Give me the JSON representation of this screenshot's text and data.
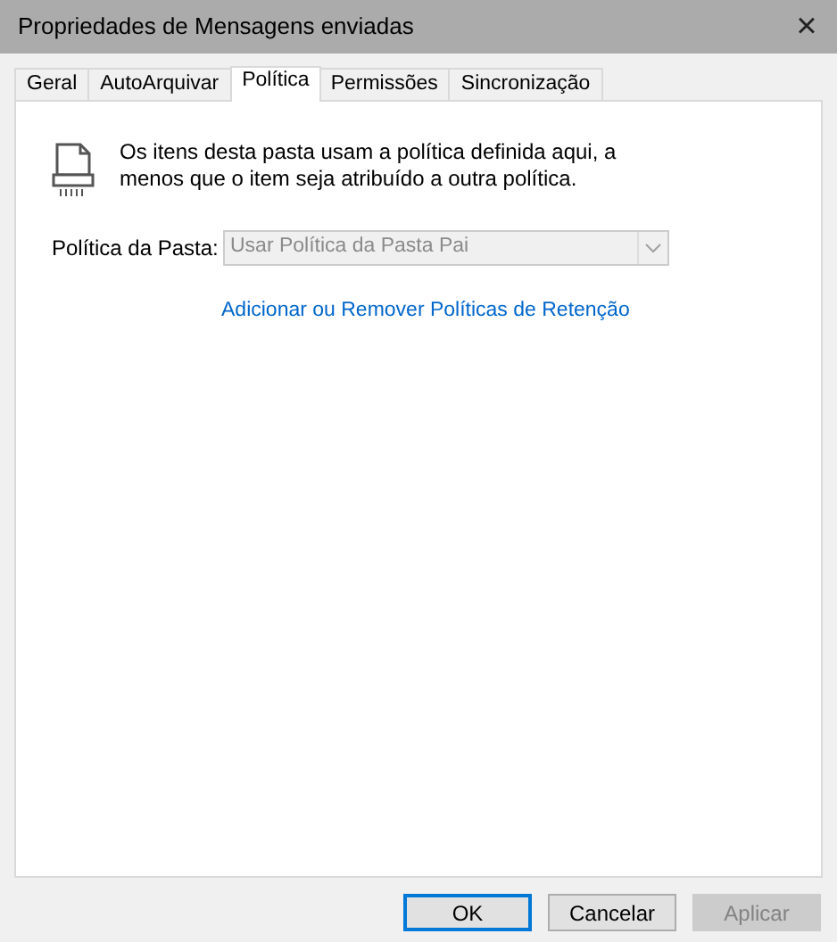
{
  "window": {
    "title": "Propriedades de Mensagens enviadas",
    "close": "×"
  },
  "tabs": [
    {
      "label": "Geral",
      "selected": false
    },
    {
      "label": "AutoArquivar",
      "selected": false
    },
    {
      "label": "Política",
      "selected": true
    },
    {
      "label": "Permissões",
      "selected": false
    },
    {
      "label": "Sincronização",
      "selected": false
    }
  ],
  "policy": {
    "description": "Os itens desta pasta usam a política definida aqui, a menos que o item seja atribuído a outra política.",
    "folder_policy_label": "Política da Pasta:",
    "folder_policy_value": "Usar Política da Pasta Pai",
    "folder_policy_disabled": true,
    "link": "Adicionar ou Remover Políticas de Retenção"
  },
  "buttons": [
    {
      "label": "OK",
      "default": true,
      "disabled": false
    },
    {
      "label": "Cancelar",
      "default": false,
      "disabled": false
    },
    {
      "label": "Aplicar",
      "default": false,
      "disabled": true
    }
  ]
}
